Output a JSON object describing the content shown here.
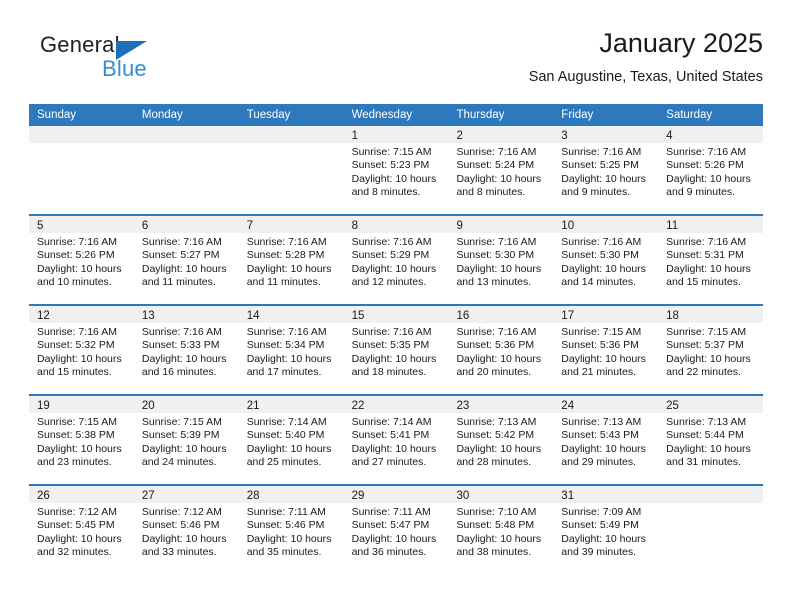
{
  "brand": {
    "name_top": "General",
    "name_bottom": "Blue",
    "color_dark": "#231f20",
    "color_blue": "#2e8fd6",
    "triangle_color": "#1d6fb8"
  },
  "header": {
    "title": "January 2025",
    "subtitle": "San Augustine, Texas, United States"
  },
  "theme": {
    "header_row_bg": "#2e79bd",
    "header_row_text": "#ffffff",
    "day_strip_bg": "#f0f0f0",
    "week_divider": "#2e79bd"
  },
  "weekdays": [
    "Sunday",
    "Monday",
    "Tuesday",
    "Wednesday",
    "Thursday",
    "Friday",
    "Saturday"
  ],
  "weeks": [
    [
      {
        "day": "",
        "sunrise": "",
        "sunset": "",
        "daylight": "",
        "empty": true
      },
      {
        "day": "",
        "sunrise": "",
        "sunset": "",
        "daylight": "",
        "empty": true
      },
      {
        "day": "",
        "sunrise": "",
        "sunset": "",
        "daylight": "",
        "empty": true
      },
      {
        "day": "1",
        "sunrise": "Sunrise: 7:15 AM",
        "sunset": "Sunset: 5:23 PM",
        "daylight": "Daylight: 10 hours and 8 minutes."
      },
      {
        "day": "2",
        "sunrise": "Sunrise: 7:16 AM",
        "sunset": "Sunset: 5:24 PM",
        "daylight": "Daylight: 10 hours and 8 minutes."
      },
      {
        "day": "3",
        "sunrise": "Sunrise: 7:16 AM",
        "sunset": "Sunset: 5:25 PM",
        "daylight": "Daylight: 10 hours and 9 minutes."
      },
      {
        "day": "4",
        "sunrise": "Sunrise: 7:16 AM",
        "sunset": "Sunset: 5:26 PM",
        "daylight": "Daylight: 10 hours and 9 minutes."
      }
    ],
    [
      {
        "day": "5",
        "sunrise": "Sunrise: 7:16 AM",
        "sunset": "Sunset: 5:26 PM",
        "daylight": "Daylight: 10 hours and 10 minutes."
      },
      {
        "day": "6",
        "sunrise": "Sunrise: 7:16 AM",
        "sunset": "Sunset: 5:27 PM",
        "daylight": "Daylight: 10 hours and 11 minutes."
      },
      {
        "day": "7",
        "sunrise": "Sunrise: 7:16 AM",
        "sunset": "Sunset: 5:28 PM",
        "daylight": "Daylight: 10 hours and 11 minutes."
      },
      {
        "day": "8",
        "sunrise": "Sunrise: 7:16 AM",
        "sunset": "Sunset: 5:29 PM",
        "daylight": "Daylight: 10 hours and 12 minutes."
      },
      {
        "day": "9",
        "sunrise": "Sunrise: 7:16 AM",
        "sunset": "Sunset: 5:30 PM",
        "daylight": "Daylight: 10 hours and 13 minutes."
      },
      {
        "day": "10",
        "sunrise": "Sunrise: 7:16 AM",
        "sunset": "Sunset: 5:30 PM",
        "daylight": "Daylight: 10 hours and 14 minutes."
      },
      {
        "day": "11",
        "sunrise": "Sunrise: 7:16 AM",
        "sunset": "Sunset: 5:31 PM",
        "daylight": "Daylight: 10 hours and 15 minutes."
      }
    ],
    [
      {
        "day": "12",
        "sunrise": "Sunrise: 7:16 AM",
        "sunset": "Sunset: 5:32 PM",
        "daylight": "Daylight: 10 hours and 15 minutes."
      },
      {
        "day": "13",
        "sunrise": "Sunrise: 7:16 AM",
        "sunset": "Sunset: 5:33 PM",
        "daylight": "Daylight: 10 hours and 16 minutes."
      },
      {
        "day": "14",
        "sunrise": "Sunrise: 7:16 AM",
        "sunset": "Sunset: 5:34 PM",
        "daylight": "Daylight: 10 hours and 17 minutes."
      },
      {
        "day": "15",
        "sunrise": "Sunrise: 7:16 AM",
        "sunset": "Sunset: 5:35 PM",
        "daylight": "Daylight: 10 hours and 18 minutes."
      },
      {
        "day": "16",
        "sunrise": "Sunrise: 7:16 AM",
        "sunset": "Sunset: 5:36 PM",
        "daylight": "Daylight: 10 hours and 20 minutes."
      },
      {
        "day": "17",
        "sunrise": "Sunrise: 7:15 AM",
        "sunset": "Sunset: 5:36 PM",
        "daylight": "Daylight: 10 hours and 21 minutes."
      },
      {
        "day": "18",
        "sunrise": "Sunrise: 7:15 AM",
        "sunset": "Sunset: 5:37 PM",
        "daylight": "Daylight: 10 hours and 22 minutes."
      }
    ],
    [
      {
        "day": "19",
        "sunrise": "Sunrise: 7:15 AM",
        "sunset": "Sunset: 5:38 PM",
        "daylight": "Daylight: 10 hours and 23 minutes."
      },
      {
        "day": "20",
        "sunrise": "Sunrise: 7:15 AM",
        "sunset": "Sunset: 5:39 PM",
        "daylight": "Daylight: 10 hours and 24 minutes."
      },
      {
        "day": "21",
        "sunrise": "Sunrise: 7:14 AM",
        "sunset": "Sunset: 5:40 PM",
        "daylight": "Daylight: 10 hours and 25 minutes."
      },
      {
        "day": "22",
        "sunrise": "Sunrise: 7:14 AM",
        "sunset": "Sunset: 5:41 PM",
        "daylight": "Daylight: 10 hours and 27 minutes."
      },
      {
        "day": "23",
        "sunrise": "Sunrise: 7:13 AM",
        "sunset": "Sunset: 5:42 PM",
        "daylight": "Daylight: 10 hours and 28 minutes."
      },
      {
        "day": "24",
        "sunrise": "Sunrise: 7:13 AM",
        "sunset": "Sunset: 5:43 PM",
        "daylight": "Daylight: 10 hours and 29 minutes."
      },
      {
        "day": "25",
        "sunrise": "Sunrise: 7:13 AM",
        "sunset": "Sunset: 5:44 PM",
        "daylight": "Daylight: 10 hours and 31 minutes."
      }
    ],
    [
      {
        "day": "26",
        "sunrise": "Sunrise: 7:12 AM",
        "sunset": "Sunset: 5:45 PM",
        "daylight": "Daylight: 10 hours and 32 minutes."
      },
      {
        "day": "27",
        "sunrise": "Sunrise: 7:12 AM",
        "sunset": "Sunset: 5:46 PM",
        "daylight": "Daylight: 10 hours and 33 minutes."
      },
      {
        "day": "28",
        "sunrise": "Sunrise: 7:11 AM",
        "sunset": "Sunset: 5:46 PM",
        "daylight": "Daylight: 10 hours and 35 minutes."
      },
      {
        "day": "29",
        "sunrise": "Sunrise: 7:11 AM",
        "sunset": "Sunset: 5:47 PM",
        "daylight": "Daylight: 10 hours and 36 minutes."
      },
      {
        "day": "30",
        "sunrise": "Sunrise: 7:10 AM",
        "sunset": "Sunset: 5:48 PM",
        "daylight": "Daylight: 10 hours and 38 minutes."
      },
      {
        "day": "31",
        "sunrise": "Sunrise: 7:09 AM",
        "sunset": "Sunset: 5:49 PM",
        "daylight": "Daylight: 10 hours and 39 minutes."
      },
      {
        "day": "",
        "sunrise": "",
        "sunset": "",
        "daylight": "",
        "empty": true
      }
    ]
  ]
}
